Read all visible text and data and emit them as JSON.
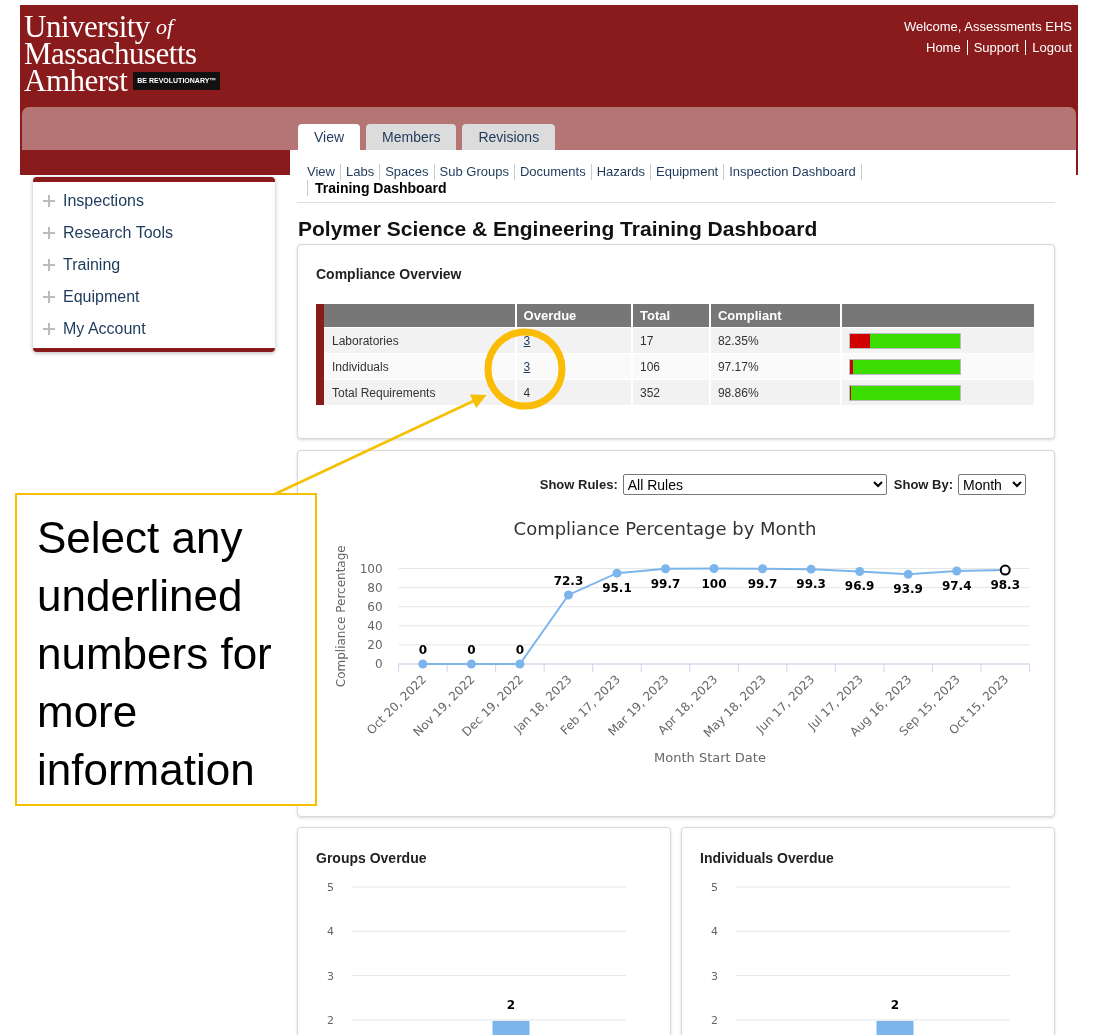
{
  "logo": {
    "line1": "University",
    "of": "of",
    "line2": "Massachusetts",
    "line3": "Amherst",
    "tagline": "BE REVOLUTIONARY™"
  },
  "user": {
    "welcome": "Welcome, Assessments EHS",
    "links": [
      "Home",
      "Support",
      "Logout"
    ]
  },
  "tabs": [
    {
      "label": "View",
      "selected": true
    },
    {
      "label": "Members",
      "selected": false
    },
    {
      "label": "Revisions",
      "selected": false
    }
  ],
  "subnav": [
    "View",
    "Labs",
    "Spaces",
    "Sub Groups",
    "Documents",
    "Hazards",
    "Equipment",
    "Inspection Dashboard"
  ],
  "subnav_current": "Training Dashboard",
  "sidebar": {
    "items": [
      {
        "label": "Inspections",
        "expanded": false
      },
      {
        "label": "Research Tools",
        "expanded": false
      },
      {
        "label": "Training",
        "expanded": false
      },
      {
        "label": "Equipment",
        "expanded": false
      },
      {
        "label": "My Account",
        "expanded": false
      }
    ]
  },
  "page_title": "Polymer Science & Engineering Training Dashboard",
  "overview": {
    "title": "Compliance Overview",
    "columns": [
      "Overdue",
      "Total",
      "Compliant"
    ],
    "rows": [
      {
        "label": "Laboratories",
        "overdue": "3",
        "overdue_link": true,
        "total": "17",
        "compliant": "82.35%",
        "level": 0.8235
      },
      {
        "label": "Individuals",
        "overdue": "3",
        "overdue_link": true,
        "total": "106",
        "compliant": "97.17%",
        "level": 0.9717
      },
      {
        "label": "Total Requirements",
        "overdue": "4",
        "overdue_link": false,
        "total": "352",
        "compliant": "98.86%",
        "level": 0.9886
      }
    ]
  },
  "filters": [
    {
      "label": "Show Rules:",
      "value": "All Rules",
      "kind": "wide"
    },
    {
      "label": "Show By:",
      "value": "Month",
      "kind": "narrow"
    }
  ],
  "line_chart": {
    "chart_data": {
      "type": "line",
      "title": "Compliance Percentage by Month",
      "xlabel": "Month Start Date",
      "ylabel": "Compliance Percentage",
      "categories": [
        "Oct 20, 2022",
        "Nov 19, 2022",
        "Dec 19, 2022",
        "Jan 18, 2023",
        "Feb 17, 2023",
        "Mar 19, 2023",
        "Apr 18, 2023",
        "May 18, 2023",
        "Jun 17, 2023",
        "Jul 17, 2023",
        "Aug 16, 2023",
        "Sep 15, 2023",
        "Oct 15, 2023"
      ],
      "series": [
        {
          "color": "#7cb5ec",
          "marker": true,
          "values": [
            0,
            0,
            0,
            72.3,
            95.1,
            99.7,
            100,
            99.7,
            99.3,
            96.9,
            93.9,
            97.4,
            98.3
          ]
        }
      ],
      "grid": true,
      "ylim": [
        0,
        100
      ],
      "yticks": [
        0,
        20,
        40,
        60,
        80,
        100
      ],
      "data_labels": true
    }
  },
  "bar_charts": [
    {
      "title": "Groups Overdue",
      "chart_data": {
        "type": "bar",
        "series": [
          {
            "color": "#7cb5ec",
            "values": [
              2
            ]
          }
        ],
        "ylim": [
          0,
          5
        ],
        "yticks": [
          2,
          3,
          4,
          5
        ],
        "grid": true,
        "data_labels": true
      }
    },
    {
      "title": "Individuals Overdue",
      "chart_data": {
        "type": "bar",
        "series": [
          {
            "color": "#7cb5ec",
            "values": [
              2
            ]
          }
        ],
        "ylim": [
          0,
          5
        ],
        "yticks": [
          2,
          3,
          4,
          5
        ],
        "grid": true,
        "data_labels": true
      }
    }
  ],
  "callout": {
    "text": "Select any underlined numbers for more information"
  }
}
